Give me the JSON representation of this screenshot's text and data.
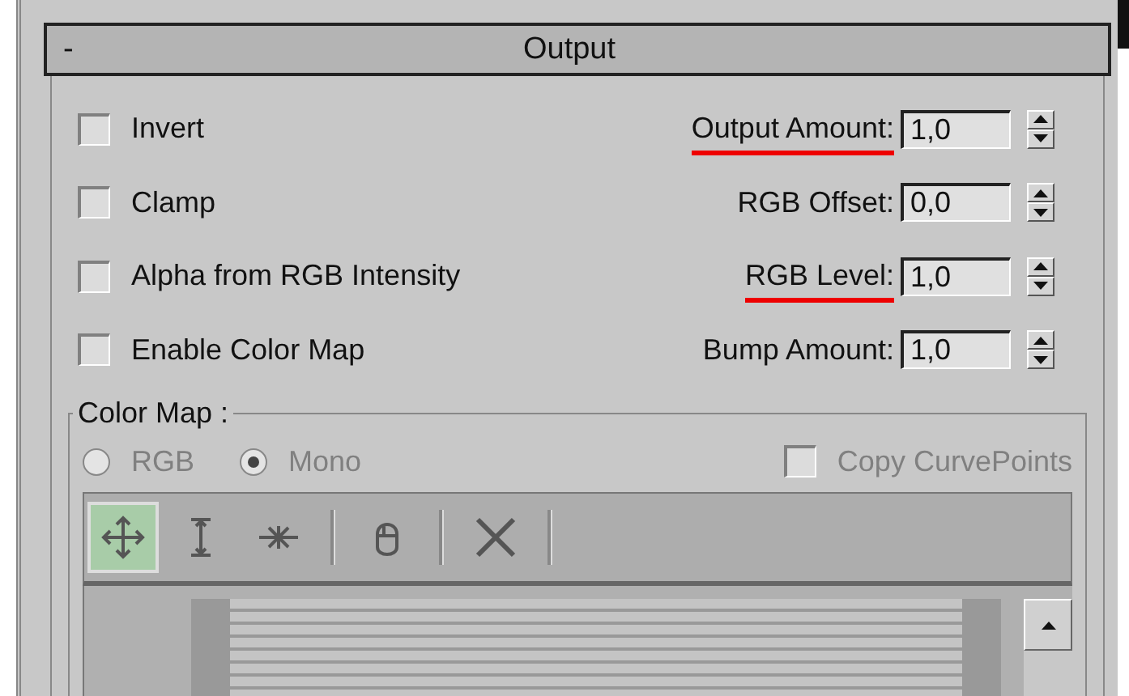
{
  "rollout": {
    "title": "Output",
    "collapse": "-"
  },
  "checkboxes": [
    {
      "label": "Invert",
      "checked": false
    },
    {
      "label": "Clamp",
      "checked": false
    },
    {
      "label": "Alpha from RGB Intensity",
      "checked": false
    },
    {
      "label": "Enable Color Map",
      "checked": false
    }
  ],
  "spinners": [
    {
      "label": "Output Amount:",
      "value": "1,0",
      "underlined": true
    },
    {
      "label": "RGB Offset:",
      "value": "0,0",
      "underlined": false
    },
    {
      "label": "RGB Level:",
      "value": "1,0",
      "underlined": true
    },
    {
      "label": "Bump Amount:",
      "value": "1,0",
      "underlined": false
    }
  ],
  "color_map": {
    "title": "Color Map :",
    "modes": [
      {
        "label": "RGB",
        "selected": false
      },
      {
        "label": "Mono",
        "selected": true
      }
    ],
    "copy_curve_points": {
      "label": "Copy CurvePoints",
      "checked": false
    },
    "tools": [
      {
        "kind": "move",
        "selected": true
      },
      {
        "kind": "scale",
        "selected": false
      },
      {
        "kind": "insert",
        "selected": false
      },
      {
        "kind": "sep"
      },
      {
        "kind": "pan",
        "selected": false
      },
      {
        "kind": "sep"
      },
      {
        "kind": "delete",
        "selected": false
      },
      {
        "kind": "sep"
      }
    ]
  }
}
